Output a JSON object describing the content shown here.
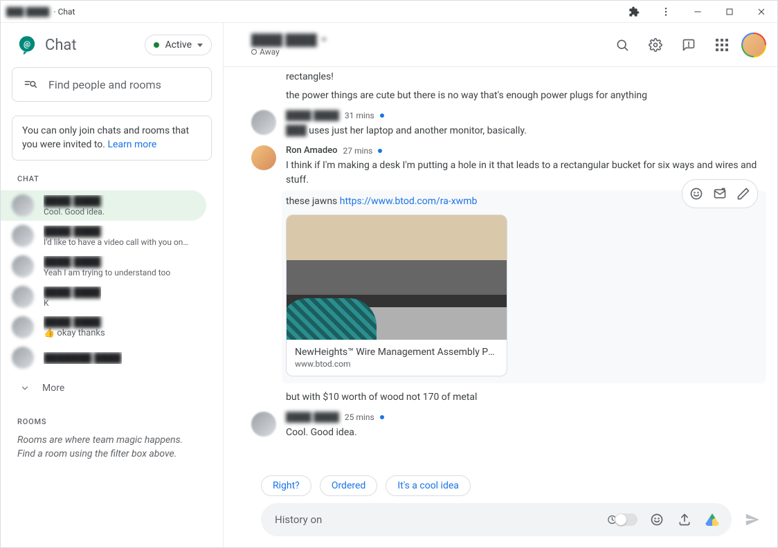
{
  "window": {
    "title_suffix": " · Chat"
  },
  "sidebar": {
    "app_name": "Chat",
    "status_label": "Active",
    "search_placeholder": "Find people and rooms",
    "info_text": "You can only join chats and rooms that you were invited to. ",
    "info_link": "Learn more",
    "chat_label": "CHAT",
    "items": [
      {
        "preview": "Cool. Good idea.",
        "active": true
      },
      {
        "preview": "I'd like to have a video call with you on …"
      },
      {
        "preview": "Yeah I am trying to understand too"
      },
      {
        "preview": "K"
      },
      {
        "preview": "👍 okay thanks"
      },
      {
        "preview": ""
      }
    ],
    "more_label": "More",
    "rooms_label": "ROOMS",
    "rooms_text1": "Rooms are where team magic happens.",
    "rooms_text2": "Find a room using the filter box above."
  },
  "header": {
    "away_label": "Away"
  },
  "messages": {
    "pre1": "rectangles!",
    "pre2": "the power things are cute but there is no way that's enough power plugs for anything",
    "m1_time": "31 mins",
    "m1_body": " uses just her laptop and another monitor, basically.",
    "m2_sender": "Ron Amadeo",
    "m2_time": "27 mins",
    "m2_line1": "I think if I'm making a desk I'm putting a hole in it that leads to a rectangular bucket for six ways and wires and stuff.",
    "m2_line2a": "these jawns ",
    "m2_link": "https://www.btod.com/ra-xwmb",
    "card_title": "NewHeights™ Wire Management Assembly Pack",
    "card_domain": "www.btod.com",
    "m2_line3": "but with $10 worth of wood not 170 of metal",
    "m3_time": "25 mins",
    "m3_body": "Cool. Good idea."
  },
  "smart_replies": [
    "Right?",
    "Ordered",
    "It's a cool idea"
  ],
  "composer": {
    "history_label": "History on"
  }
}
